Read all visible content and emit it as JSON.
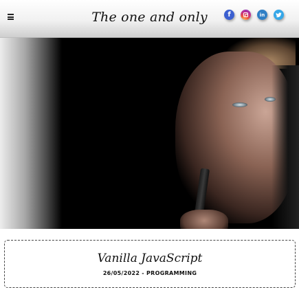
{
  "header": {
    "site_title": "The one and only",
    "menu_icon": "hamburger-menu-icon",
    "socials": [
      {
        "name": "facebook",
        "glyph": "f",
        "color": "#3b5fd0"
      },
      {
        "name": "instagram",
        "glyph": "",
        "color": "#c22d8a"
      },
      {
        "name": "linkedin",
        "glyph": "in",
        "color": "#2f7fc5"
      },
      {
        "name": "twitter",
        "glyph": "🐦",
        "color": "#35a7e8"
      }
    ]
  },
  "hero": {
    "image": "hero-portrait-image"
  },
  "post": {
    "title": "Vanilla JavaScript",
    "meta": "26/05/2022 - PROGRAMMING"
  }
}
